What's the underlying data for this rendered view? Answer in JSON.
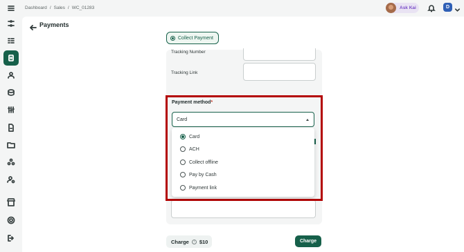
{
  "breadcrumb": [
    "Dashboard",
    "/",
    "Sales",
    "/",
    "WC_01283"
  ],
  "header": {
    "ask_kai": "Ask Kai",
    "profile_initial": "D"
  },
  "page": {
    "title": "Payments"
  },
  "collect_payment": {
    "label": "Collect Payment"
  },
  "fields": {
    "tracking_number_label": "Tracking Number",
    "tracking_link_label": "Tracking Link"
  },
  "payment_method": {
    "label": "Payment method",
    "required_mark": "*",
    "selected": "Card",
    "options": [
      "Card",
      "ACH",
      "Collect offline",
      "Pay by Cash",
      "Payment link"
    ]
  },
  "footer": {
    "charge_label": "Charge",
    "charge_info_glyph": "i",
    "amount": "$10",
    "charge_button": "Charge"
  },
  "colors": {
    "accent": "#16604a",
    "highlight": "#b30000",
    "kai": "#7b4fc8"
  },
  "sidebar_icons": [
    "menu-icon",
    "filters-icon",
    "list-icon",
    "orders-icon",
    "user-icon",
    "coins-icon",
    "sliders-icon",
    "document-icon",
    "folder-icon",
    "team-icon",
    "user-settings-icon",
    "store-icon",
    "gear-icon",
    "logout-icon"
  ]
}
